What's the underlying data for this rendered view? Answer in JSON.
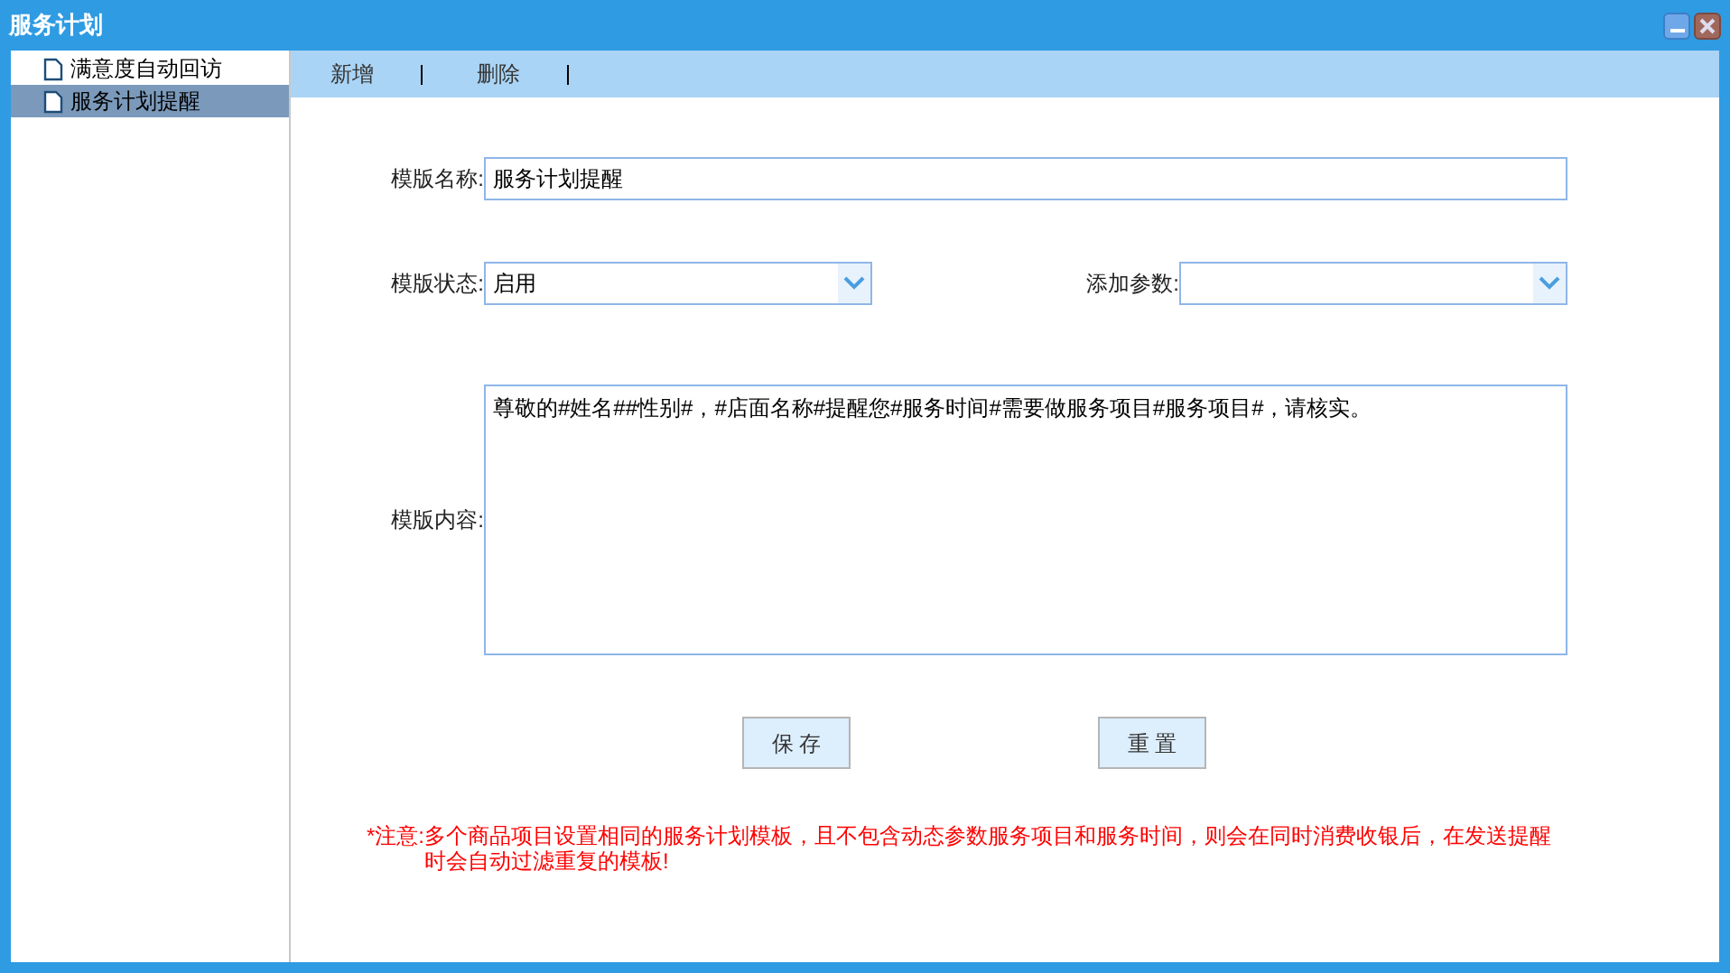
{
  "window": {
    "title": "服务计划"
  },
  "sidebar": {
    "items": [
      {
        "label": "满意度自动回访",
        "selected": false
      },
      {
        "label": "服务计划提醒",
        "selected": true
      }
    ]
  },
  "toolbar": {
    "buttons": [
      "新增",
      "删除"
    ]
  },
  "form": {
    "name": {
      "label": "模版名称:",
      "value": "服务计划提醒"
    },
    "status": {
      "label": "模版状态:",
      "value": "启用"
    },
    "params": {
      "label": "添加参数:"
    },
    "content": {
      "label": "模版内容:",
      "value": "尊敬的#姓名##性别#，#店面名称#提醒您#服务时间#需要做服务项目#服务项目#，请核实。"
    },
    "buttons": [
      "保 存",
      "重 置"
    ],
    "note": {
      "label": "*注意:",
      "text": "多个商品项目设置相同的服务计划模板，且不包含动态参数服务项目和服务时间，则会在同时消费收银后，在发送提醒时会自动过滤重复的模板!"
    }
  }
}
